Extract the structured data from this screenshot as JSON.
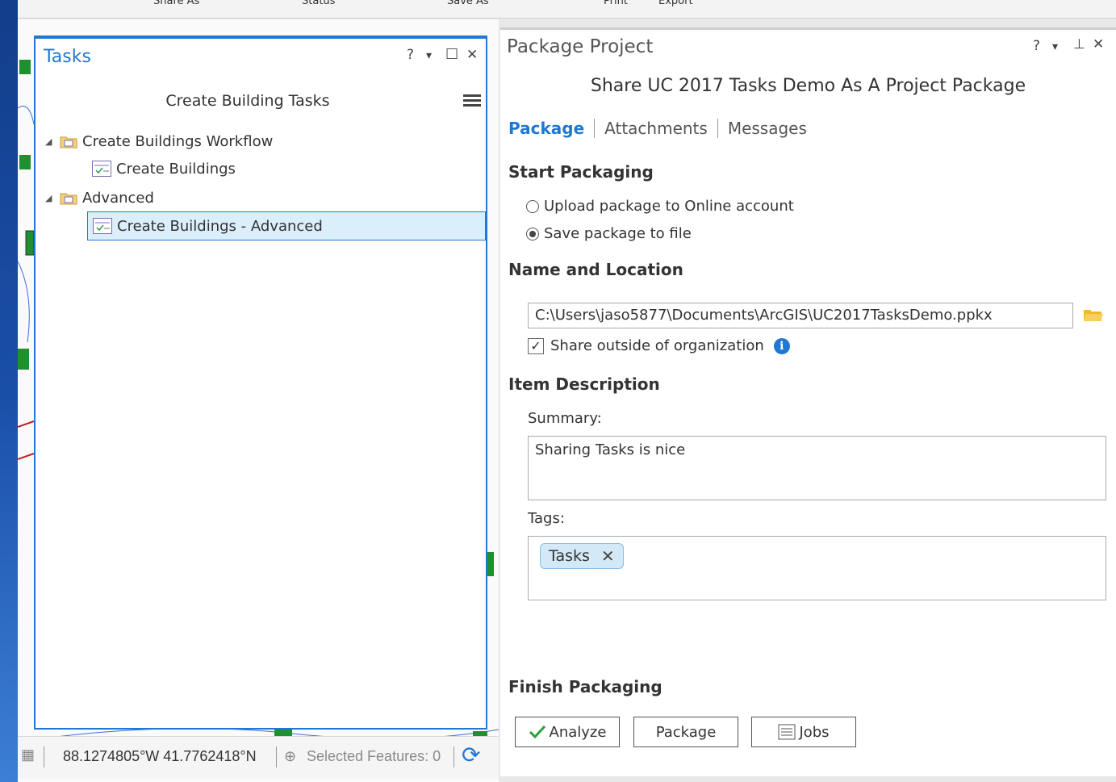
{
  "ribbon": {
    "items": [
      "Share As",
      "Status",
      "Save As",
      "Print",
      "Export"
    ]
  },
  "tasks_pane": {
    "title": "Tasks",
    "controls": {
      "help": "?",
      "menu": "▾",
      "maximize": "□",
      "close": "✕"
    },
    "heading": "Create Building Tasks",
    "tree": [
      {
        "label": "Create Buildings Workflow",
        "type": "group"
      },
      {
        "label": "Create Buildings",
        "type": "task"
      },
      {
        "label": "Advanced",
        "type": "group"
      },
      {
        "label": "Create Buildings - Advanced",
        "type": "task",
        "selected": true
      }
    ]
  },
  "status_bar": {
    "coordinates": "88.1274805°W 41.7762418°N",
    "selected_features": "Selected Features: 0"
  },
  "package_pane": {
    "title": "Package Project",
    "controls": {
      "help": "?",
      "menu": "▾",
      "pin": "⊥",
      "close": "✕"
    },
    "subtitle": "Share UC 2017 Tasks Demo As A Project Package",
    "tabs": [
      "Package",
      "Attachments",
      "Messages"
    ],
    "active_tab": "Package",
    "start_packaging": {
      "heading": "Start Packaging",
      "options": [
        "Upload package to Online account",
        "Save package to file"
      ],
      "selected": "Save package to file"
    },
    "name_location": {
      "heading": "Name and Location",
      "path": "C:\\Users\\jaso5877\\Documents\\ArcGIS\\UC2017TasksDemo.ppkx",
      "share_outside_label": "Share outside of organization",
      "share_outside_checked": true
    },
    "item_description": {
      "heading": "Item Description",
      "summary_label": "Summary:",
      "summary_value": "Sharing Tasks is nice",
      "tags_label": "Tags:",
      "tags": [
        "Tasks"
      ]
    },
    "finish": {
      "heading": "Finish Packaging",
      "buttons": {
        "analyze": "Analyze",
        "package": "Package",
        "jobs": "Jobs"
      }
    }
  },
  "colors": {
    "accent": "#1f78d1",
    "selected_bg": "#dbeefb",
    "check_green": "#2e9e3e"
  }
}
